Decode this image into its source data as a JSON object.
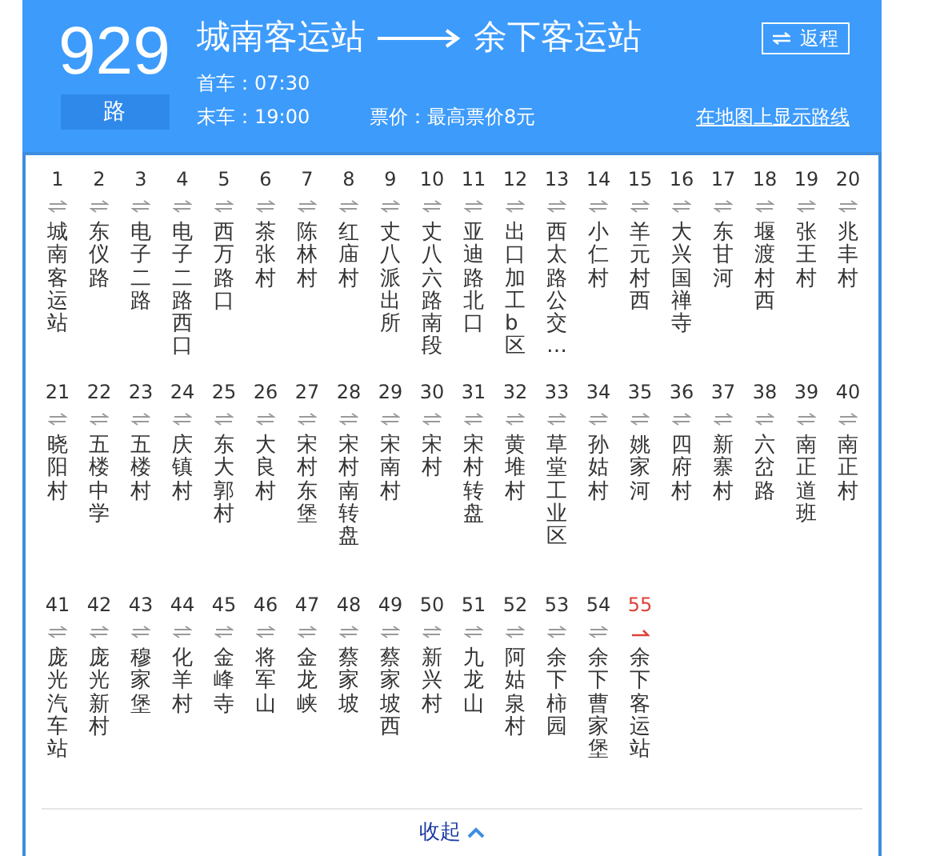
{
  "route": {
    "number": "929",
    "suffix": "路",
    "origin": "城南客运站",
    "destination": "余下客运站",
    "first_bus": "首车：07:30",
    "last_bus": "末车：19:00",
    "fare": "票价：最高票价8元",
    "reverse_button": "返程",
    "map_link": "在地图上显示路线"
  },
  "stops": [
    {
      "index": "1",
      "name": "城南客运站",
      "kind": "two_way"
    },
    {
      "index": "2",
      "name": "东仪路",
      "kind": "two_way"
    },
    {
      "index": "3",
      "name": "电子二路",
      "kind": "two_way"
    },
    {
      "index": "4",
      "name": "电子二路西口",
      "kind": "two_way"
    },
    {
      "index": "5",
      "name": "西万路口",
      "kind": "two_way"
    },
    {
      "index": "6",
      "name": "茶张村",
      "kind": "two_way"
    },
    {
      "index": "7",
      "name": "陈林村",
      "kind": "two_way"
    },
    {
      "index": "8",
      "name": "红庙村",
      "kind": "two_way"
    },
    {
      "index": "9",
      "name": "丈八派出所",
      "kind": "two_way"
    },
    {
      "index": "10",
      "name": "丈八六路南段",
      "kind": "two_way"
    },
    {
      "index": "11",
      "name": "亚迪路北口",
      "kind": "two_way"
    },
    {
      "index": "12",
      "name": "出口加工b区",
      "kind": "two_way"
    },
    {
      "index": "13",
      "name": "西太路公交…",
      "kind": "two_way"
    },
    {
      "index": "14",
      "name": "小仁村",
      "kind": "two_way"
    },
    {
      "index": "15",
      "name": "羊元村西",
      "kind": "two_way"
    },
    {
      "index": "16",
      "name": "大兴国禅寺",
      "kind": "two_way"
    },
    {
      "index": "17",
      "name": "东甘河",
      "kind": "two_way"
    },
    {
      "index": "18",
      "name": "堰渡村西",
      "kind": "two_way"
    },
    {
      "index": "19",
      "name": "张王村",
      "kind": "two_way"
    },
    {
      "index": "20",
      "name": "兆丰村",
      "kind": "two_way"
    },
    {
      "index": "21",
      "name": "晓阳村",
      "kind": "two_way"
    },
    {
      "index": "22",
      "name": "五楼中学",
      "kind": "two_way"
    },
    {
      "index": "23",
      "name": "五楼村",
      "kind": "two_way"
    },
    {
      "index": "24",
      "name": "庆镇村",
      "kind": "two_way"
    },
    {
      "index": "25",
      "name": "东大郭村",
      "kind": "two_way"
    },
    {
      "index": "26",
      "name": "大良村",
      "kind": "two_way"
    },
    {
      "index": "27",
      "name": "宋村东堡",
      "kind": "two_way"
    },
    {
      "index": "28",
      "name": "宋村南转盘",
      "kind": "two_way"
    },
    {
      "index": "29",
      "name": "宋南村",
      "kind": "two_way"
    },
    {
      "index": "30",
      "name": "宋村",
      "kind": "two_way"
    },
    {
      "index": "31",
      "name": "宋村转盘",
      "kind": "two_way"
    },
    {
      "index": "32",
      "name": "黄堆村",
      "kind": "two_way"
    },
    {
      "index": "33",
      "name": "草堂工业区",
      "kind": "two_way"
    },
    {
      "index": "34",
      "name": "孙姑村",
      "kind": "two_way"
    },
    {
      "index": "35",
      "name": "姚家河",
      "kind": "two_way"
    },
    {
      "index": "36",
      "name": "四府村",
      "kind": "two_way"
    },
    {
      "index": "37",
      "name": "新寨村",
      "kind": "two_way"
    },
    {
      "index": "38",
      "name": "六岔路",
      "kind": "two_way"
    },
    {
      "index": "39",
      "name": "南正道班",
      "kind": "two_way"
    },
    {
      "index": "40",
      "name": "南正村",
      "kind": "two_way"
    },
    {
      "index": "41",
      "name": "庞光汽车站",
      "kind": "two_way"
    },
    {
      "index": "42",
      "name": "庞光新村",
      "kind": "two_way"
    },
    {
      "index": "43",
      "name": "穆家堡",
      "kind": "two_way"
    },
    {
      "index": "44",
      "name": "化羊村",
      "kind": "two_way"
    },
    {
      "index": "45",
      "name": "金峰寺",
      "kind": "two_way"
    },
    {
      "index": "46",
      "name": "将军山",
      "kind": "two_way"
    },
    {
      "index": "47",
      "name": "金龙峡",
      "kind": "two_way"
    },
    {
      "index": "48",
      "name": "蔡家坡",
      "kind": "two_way"
    },
    {
      "index": "49",
      "name": "蔡家坡西",
      "kind": "two_way"
    },
    {
      "index": "50",
      "name": "新兴村",
      "kind": "two_way"
    },
    {
      "index": "51",
      "name": "九龙山",
      "kind": "two_way"
    },
    {
      "index": "52",
      "name": "阿姑泉村",
      "kind": "two_way"
    },
    {
      "index": "53",
      "name": "余下柿园",
      "kind": "two_way"
    },
    {
      "index": "54",
      "name": "余下曹家堡",
      "kind": "two_way"
    },
    {
      "index": "55",
      "name": "余下客运站",
      "kind": "terminal"
    }
  ],
  "collapse_link": "收起"
}
